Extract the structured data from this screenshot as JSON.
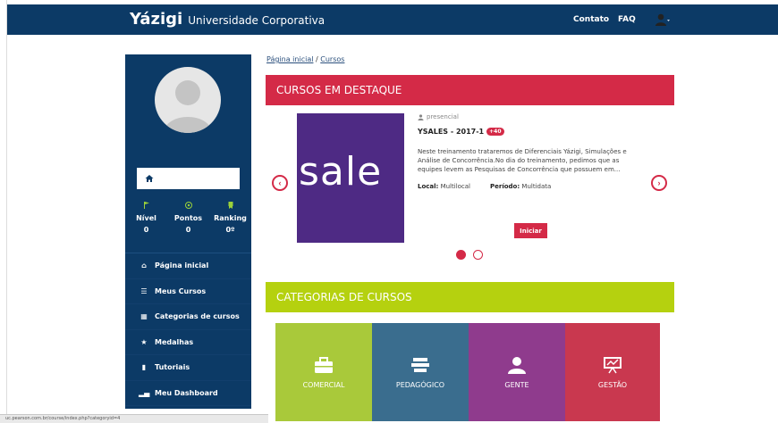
{
  "header": {
    "brand": "Yázigi",
    "subtitle": "Universidade Corporativa",
    "nav": [
      {
        "label": "Contato"
      },
      {
        "label": "FAQ"
      }
    ]
  },
  "sidebar": {
    "stats": [
      {
        "label": "Nível",
        "value": "0",
        "icon": "flag-icon"
      },
      {
        "label": "Pontos",
        "value": "0",
        "icon": "target-icon"
      },
      {
        "label": "Ranking",
        "value": "0º",
        "icon": "ribbon-icon"
      }
    ],
    "menu": [
      {
        "label": "Página inicial",
        "icon": "home-icon"
      },
      {
        "label": "Meus Cursos",
        "icon": "list-icon"
      },
      {
        "label": "Categorias de cursos",
        "icon": "grid-icon"
      },
      {
        "label": "Medalhas",
        "icon": "star-icon"
      },
      {
        "label": "Tutoriais",
        "icon": "file-icon"
      },
      {
        "label": "Meu Dashboard",
        "icon": "bar-chart-icon"
      }
    ]
  },
  "breadcrumb": {
    "home": "Página inicial",
    "separator": "/",
    "current": "Cursos"
  },
  "featured": {
    "title": "CURSOS EM DESTAQUE",
    "course": {
      "image_text": "sale",
      "type": "presencial",
      "name": "YSALES - 2017-1",
      "badge": "+40",
      "description": "Neste treinamento trataremos de Diferenciais Yázigi, Simulações e Análise de Concorrência.No dia do treinamento, pedimos que as equipes levem as Pesquisas de Concorrência que possuem em...",
      "local_label": "Local:",
      "local_value": "Multilocal",
      "period_label": "Período:",
      "period_value": "Multidata",
      "start_button": "Iniciar"
    }
  },
  "categories": {
    "title": "CATEGORIAS DE CURSOS",
    "items": [
      {
        "label": "COMERCIAL",
        "color": "#a9c93a",
        "icon": "briefcase-icon"
      },
      {
        "label": "PEDAGÓGICO",
        "color": "#3a6d8e",
        "icon": "books-icon"
      },
      {
        "label": "GENTE",
        "color": "#8f3b8d",
        "icon": "person-icon"
      },
      {
        "label": "GESTÃO",
        "color": "#c9384f",
        "icon": "presentation-icon"
      }
    ]
  },
  "status_bar": {
    "url": "uc.pearson.com.br/course/index.php?categoryid=4"
  },
  "colors": {
    "navy": "#0c3a66",
    "red": "#d42a47",
    "green": "#b5d10f"
  }
}
